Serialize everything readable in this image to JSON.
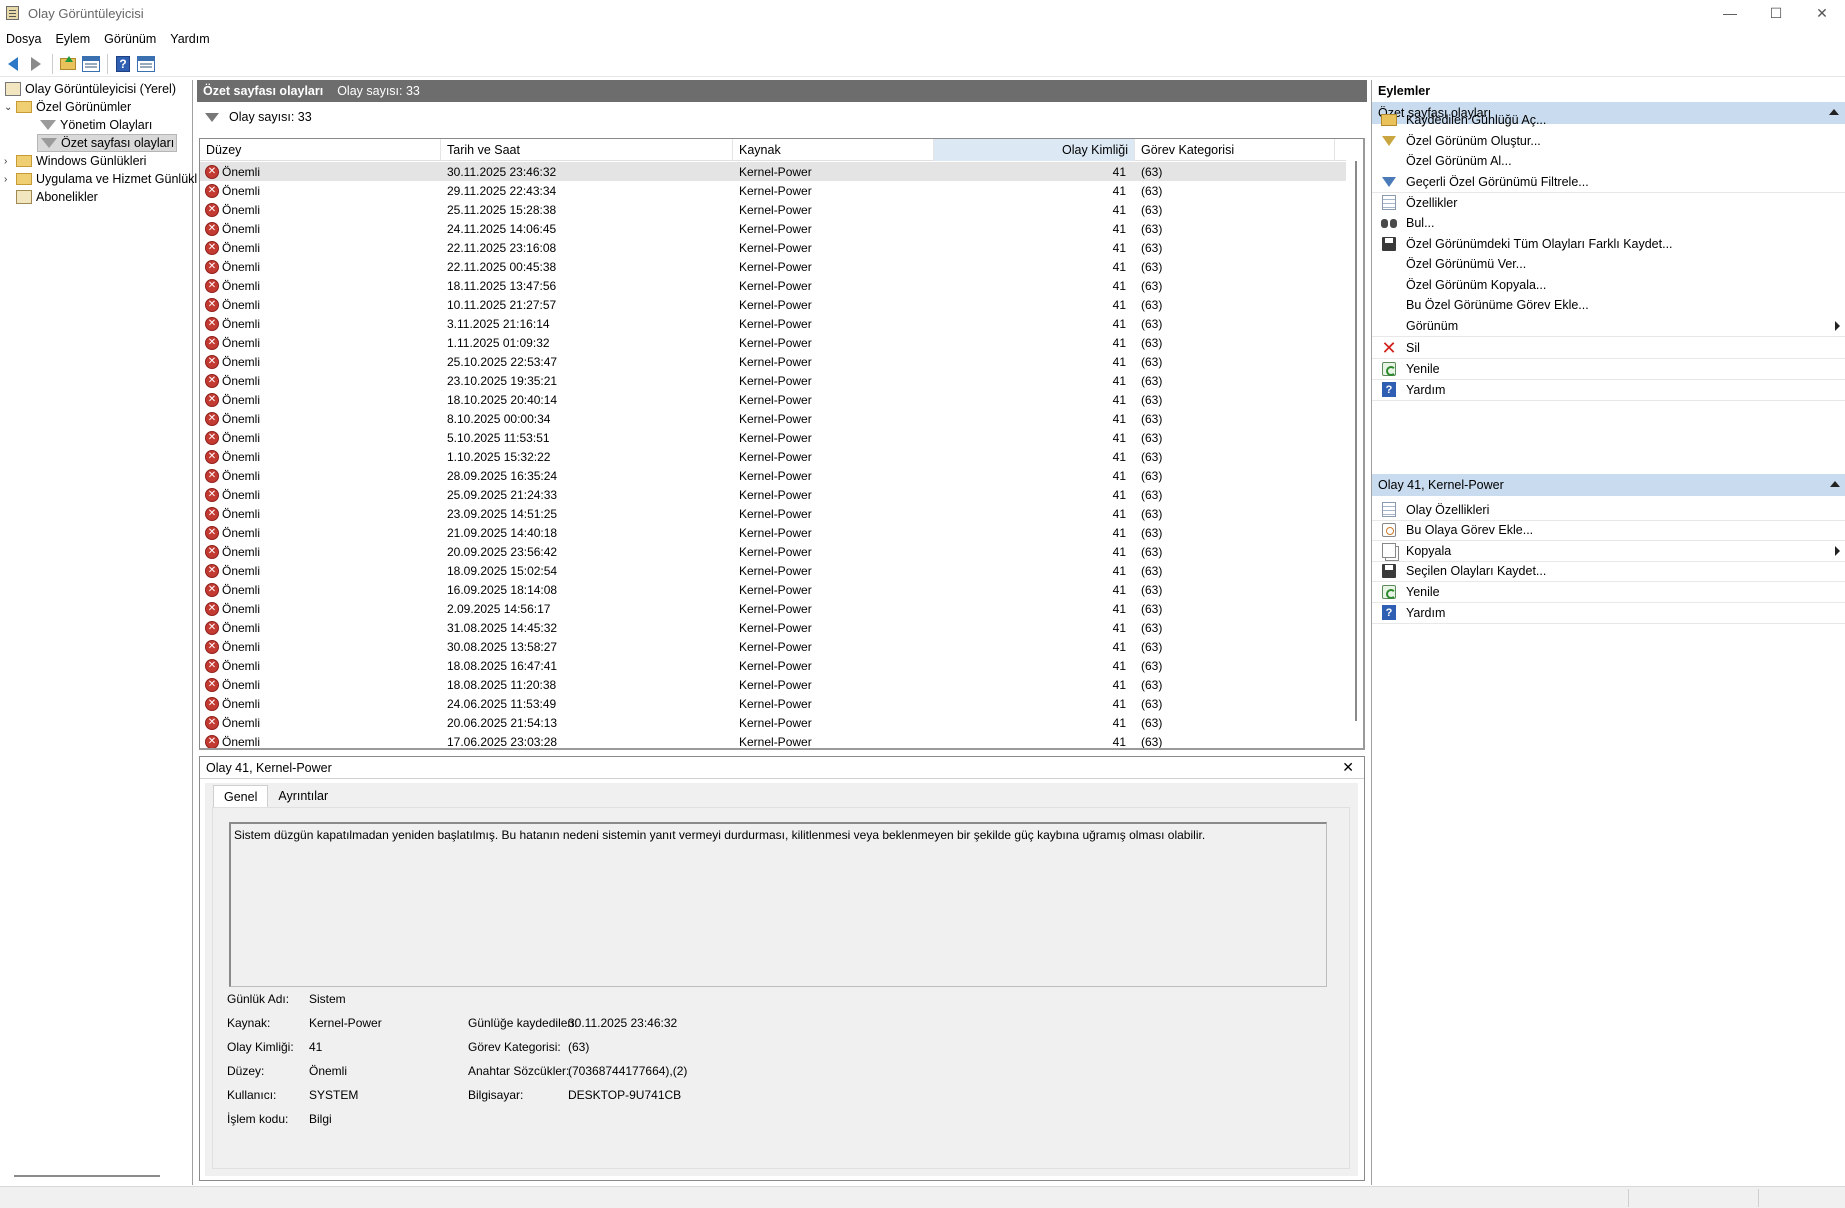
{
  "window": {
    "title": "Olay Görüntüleyicisi",
    "minimize": "—",
    "maximize": "☐",
    "close": "✕"
  },
  "menu": [
    "Dosya",
    "Eylem",
    "Görünüm",
    "Yardım"
  ],
  "tree": {
    "root": "Olay Görüntüleyicisi (Yerel)",
    "custom_views": "Özel Görünümler",
    "admin_events": "Yönetim Olayları",
    "summary_events": "Özet sayfası olayları",
    "windows_logs": "Windows Günlükleri",
    "app_service_logs": "Uygulama ve Hizmet Günlükl",
    "subscriptions": "Abonelikler"
  },
  "center": {
    "header_title": "Özet sayfası olayları",
    "header_count": "Olay sayısı: 33",
    "filter_text": "Olay sayısı: 33",
    "columns": [
      "Düzey",
      "Tarih ve Saat",
      "Kaynak",
      "Olay Kimliği",
      "Görev Kategorisi"
    ],
    "rows": [
      {
        "level": "Önemli",
        "date": "30.11.2025 23:46:32",
        "source": "Kernel-Power",
        "id": "41",
        "category": "(63)"
      },
      {
        "level": "Önemli",
        "date": "29.11.2025 22:43:34",
        "source": "Kernel-Power",
        "id": "41",
        "category": "(63)"
      },
      {
        "level": "Önemli",
        "date": "25.11.2025 15:28:38",
        "source": "Kernel-Power",
        "id": "41",
        "category": "(63)"
      },
      {
        "level": "Önemli",
        "date": "24.11.2025 14:06:45",
        "source": "Kernel-Power",
        "id": "41",
        "category": "(63)"
      },
      {
        "level": "Önemli",
        "date": "22.11.2025 23:16:08",
        "source": "Kernel-Power",
        "id": "41",
        "category": "(63)"
      },
      {
        "level": "Önemli",
        "date": "22.11.2025 00:45:38",
        "source": "Kernel-Power",
        "id": "41",
        "category": "(63)"
      },
      {
        "level": "Önemli",
        "date": "18.11.2025 13:47:56",
        "source": "Kernel-Power",
        "id": "41",
        "category": "(63)"
      },
      {
        "level": "Önemli",
        "date": "10.11.2025 21:27:57",
        "source": "Kernel-Power",
        "id": "41",
        "category": "(63)"
      },
      {
        "level": "Önemli",
        "date": "3.11.2025 21:16:14",
        "source": "Kernel-Power",
        "id": "41",
        "category": "(63)"
      },
      {
        "level": "Önemli",
        "date": "1.11.2025 01:09:32",
        "source": "Kernel-Power",
        "id": "41",
        "category": "(63)"
      },
      {
        "level": "Önemli",
        "date": "25.10.2025 22:53:47",
        "source": "Kernel-Power",
        "id": "41",
        "category": "(63)"
      },
      {
        "level": "Önemli",
        "date": "23.10.2025 19:35:21",
        "source": "Kernel-Power",
        "id": "41",
        "category": "(63)"
      },
      {
        "level": "Önemli",
        "date": "18.10.2025 20:40:14",
        "source": "Kernel-Power",
        "id": "41",
        "category": "(63)"
      },
      {
        "level": "Önemli",
        "date": "8.10.2025 00:00:34",
        "source": "Kernel-Power",
        "id": "41",
        "category": "(63)"
      },
      {
        "level": "Önemli",
        "date": "5.10.2025 11:53:51",
        "source": "Kernel-Power",
        "id": "41",
        "category": "(63)"
      },
      {
        "level": "Önemli",
        "date": "1.10.2025 15:32:22",
        "source": "Kernel-Power",
        "id": "41",
        "category": "(63)"
      },
      {
        "level": "Önemli",
        "date": "28.09.2025 16:35:24",
        "source": "Kernel-Power",
        "id": "41",
        "category": "(63)"
      },
      {
        "level": "Önemli",
        "date": "25.09.2025 21:24:33",
        "source": "Kernel-Power",
        "id": "41",
        "category": "(63)"
      },
      {
        "level": "Önemli",
        "date": "23.09.2025 14:51:25",
        "source": "Kernel-Power",
        "id": "41",
        "category": "(63)"
      },
      {
        "level": "Önemli",
        "date": "21.09.2025 14:40:18",
        "source": "Kernel-Power",
        "id": "41",
        "category": "(63)"
      },
      {
        "level": "Önemli",
        "date": "20.09.2025 23:56:42",
        "source": "Kernel-Power",
        "id": "41",
        "category": "(63)"
      },
      {
        "level": "Önemli",
        "date": "18.09.2025 15:02:54",
        "source": "Kernel-Power",
        "id": "41",
        "category": "(63)"
      },
      {
        "level": "Önemli",
        "date": "16.09.2025 18:14:08",
        "source": "Kernel-Power",
        "id": "41",
        "category": "(63)"
      },
      {
        "level": "Önemli",
        "date": "2.09.2025 14:56:17",
        "source": "Kernel-Power",
        "id": "41",
        "category": "(63)"
      },
      {
        "level": "Önemli",
        "date": "31.08.2025 14:45:32",
        "source": "Kernel-Power",
        "id": "41",
        "category": "(63)"
      },
      {
        "level": "Önemli",
        "date": "30.08.2025 13:58:27",
        "source": "Kernel-Power",
        "id": "41",
        "category": "(63)"
      },
      {
        "level": "Önemli",
        "date": "18.08.2025 16:47:41",
        "source": "Kernel-Power",
        "id": "41",
        "category": "(63)"
      },
      {
        "level": "Önemli",
        "date": "18.08.2025 11:20:38",
        "source": "Kernel-Power",
        "id": "41",
        "category": "(63)"
      },
      {
        "level": "Önemli",
        "date": "24.06.2025 11:53:49",
        "source": "Kernel-Power",
        "id": "41",
        "category": "(63)"
      },
      {
        "level": "Önemli",
        "date": "20.06.2025 21:54:13",
        "source": "Kernel-Power",
        "id": "41",
        "category": "(63)"
      },
      {
        "level": "Önemli",
        "date": "17.06.2025 23:03:28",
        "source": "Kernel-Power",
        "id": "41",
        "category": "(63)"
      }
    ]
  },
  "detail": {
    "title": "Olay 41, Kernel-Power",
    "tab_general": "Genel",
    "tab_details": "Ayrıntılar",
    "description": "Sistem düzgün kapatılmadan yeniden başlatılmış. Bu hatanın nedeni sistemin yanıt vermeyi durdurması, kilitlenmesi veya beklenmeyen bir şekilde güç kaybına uğramış olması olabilir.",
    "fields": {
      "log_name_label": "Günlük Adı:",
      "log_name": "Sistem",
      "source_label": "Kaynak:",
      "source": "Kernel-Power",
      "logged_label": "Günlüğe kaydedilen:",
      "logged": "30.11.2025 23:46:32",
      "event_id_label": "Olay Kimliği:",
      "event_id": "41",
      "task_category_label": "Görev Kategorisi:",
      "task_category": "(63)",
      "level_label": "Düzey:",
      "level": "Önemli",
      "keywords_label": "Anahtar Sözcükler:",
      "keywords": "(70368744177664),(2)",
      "user_label": "Kullanıcı:",
      "user": "SYSTEM",
      "computer_label": "Bilgisayar:",
      "computer": "DESKTOP-9U741CB",
      "opcode_label": "İşlem kodu:",
      "opcode": "Bilgi"
    }
  },
  "actions": {
    "title": "Eylemler",
    "section1": "Özet sayfası olayları",
    "section1_items": [
      {
        "label": "Kaydedilen Günlüğü Aç...",
        "icon": "open-folder-icon"
      },
      {
        "label": "Özel Görünüm Oluştur...",
        "icon": "filter-icon"
      },
      {
        "label": "Özel Görünüm Al...",
        "icon": ""
      },
      {
        "label": "Geçerli Özel Görünümü Filtrele...",
        "icon": "filter-icon"
      },
      {
        "label": "Özellikler",
        "icon": "properties-icon"
      },
      {
        "label": "Bul...",
        "icon": "binoculars-icon"
      },
      {
        "label": "Özel Görünümdeki Tüm Olayları Farklı Kaydet...",
        "icon": "save-icon"
      },
      {
        "label": "Özel Görünümü Ver...",
        "icon": ""
      },
      {
        "label": "Özel Görünüm Kopyala...",
        "icon": ""
      },
      {
        "label": "Bu Özel Görünüme Görev Ekle...",
        "icon": ""
      },
      {
        "label": "Görünüm",
        "icon": ""
      },
      {
        "label": "Sil",
        "icon": "delete-icon"
      },
      {
        "label": "Yenile",
        "icon": "refresh-icon"
      },
      {
        "label": "Yardım",
        "icon": "help-icon"
      }
    ],
    "section2": "Olay 41, Kernel-Power",
    "section2_items": [
      {
        "label": "Olay Özellikleri",
        "icon": "properties-icon"
      },
      {
        "label": "Bu Olaya Görev Ekle...",
        "icon": "task-icon"
      },
      {
        "label": "Kopyala",
        "icon": "copy-icon"
      },
      {
        "label": "Seçilen Olayları Kaydet...",
        "icon": "save-icon"
      },
      {
        "label": "Yenile",
        "icon": "refresh-icon"
      },
      {
        "label": "Yardım",
        "icon": "help-icon"
      }
    ]
  }
}
